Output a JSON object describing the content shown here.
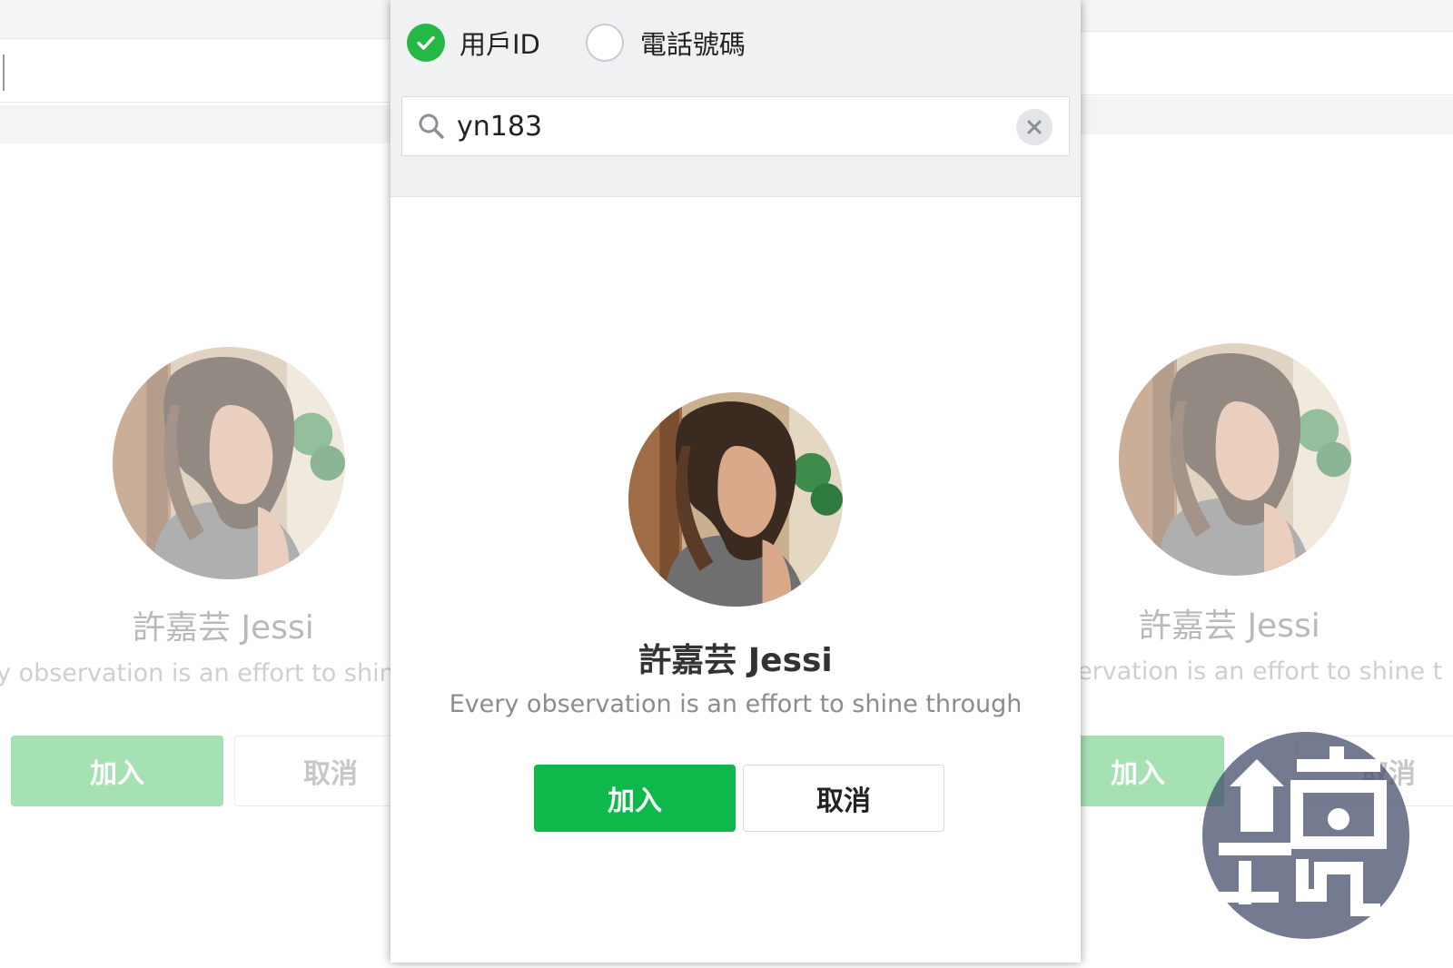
{
  "search_type": {
    "options": [
      {
        "label": "用戶ID",
        "selected": true
      },
      {
        "label": "電話號碼",
        "selected": false
      }
    ]
  },
  "search": {
    "value": "yn183",
    "clear_icon": "close-icon",
    "search_icon": "magnifier-icon"
  },
  "profile": {
    "name": "許嘉芸 Jessi",
    "status_message": "Every observation is an effort to shine through"
  },
  "actions": {
    "add_label": "加入",
    "cancel_label": "取消"
  },
  "background_left": {
    "name": "許嘉芸 Jessi",
    "status_fragment": "y observation is an effort to shin",
    "add_label": "加入",
    "cancel_label": "取消"
  },
  "background_right": {
    "name": "許嘉芸 Jessi",
    "status_fragment": "servation is an effort to shine t",
    "add_label": "加入",
    "cancel_label": "取消"
  },
  "watermark": {
    "text": "鏡週刊"
  },
  "colors": {
    "accent_green": "#0fb84a",
    "radio_checked": "#25b845",
    "faded_green": "#a6e1b4"
  }
}
